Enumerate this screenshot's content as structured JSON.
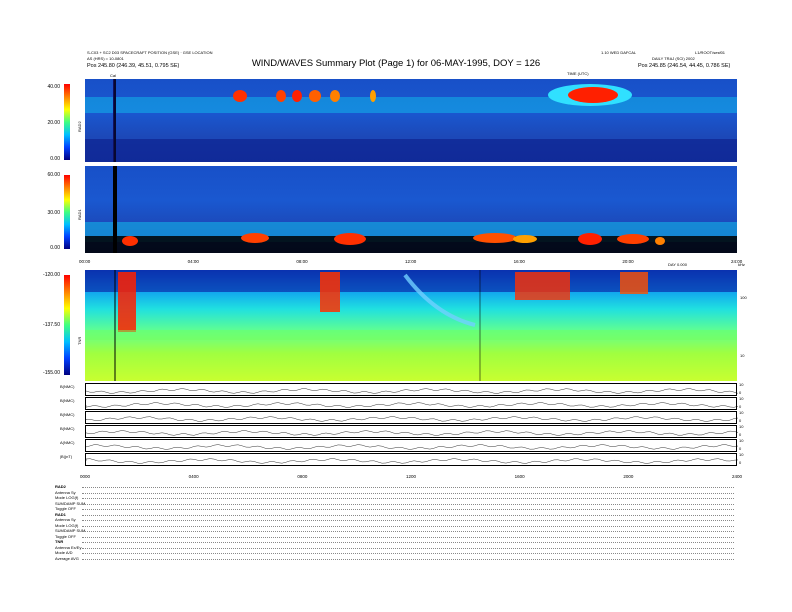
{
  "header": {
    "title": "WIND/WAVES Summary Plot (Page 1) for 06-MAY-1995, DOY = 126",
    "left_line1": "S-C03 + SC2 D03 SPACECRAFT POSITION (GSE) · GSE LOCATION",
    "left_line2": "AS (HRS) = 10-0801",
    "left_pos": "Pos  245.80 (246.39, 45.51, 0.795 SE)",
    "right_top_center": "1.10 WED DAFCAL",
    "right_top_right": "L1/ROOT/sesf01",
    "right_line2": "DAILY TRAJ (SCI) 2002",
    "right_pos": "Pos  245.85 (246.54, 44.45, 0.786 SE)",
    "time_label": "TIME (UTC)",
    "cal_label": "Cal"
  },
  "chart_data": [
    {
      "type": "heatmap",
      "name": "RAD2",
      "yticks": [
        "40.00",
        "20.00",
        "0.00"
      ],
      "ylim": [
        0,
        40
      ]
    },
    {
      "type": "heatmap",
      "name": "RAD1",
      "yticks": [
        "60.00",
        "30.00",
        "0.00"
      ],
      "ylim": [
        0,
        60
      ]
    },
    {
      "type": "heatmap",
      "name": "TNR",
      "yticks": [
        "-120.00",
        "-137.50",
        "-155.00"
      ],
      "right_ticks": [
        "100",
        "10"
      ],
      "right_unit": "kHz",
      "ylim": [
        -155,
        -120
      ]
    }
  ],
  "xaxis": {
    "ticks_top": [
      "00:00",
      "04:00",
      "08:00",
      "12:00",
      "16:00",
      "20:00",
      "24:00"
    ],
    "ticks_bottom": [
      "0000",
      "0400",
      "0800",
      "1200",
      "1600",
      "2000",
      "2400"
    ],
    "label": "DAY 0.000"
  },
  "strips": [
    {
      "label": "B(NMC)",
      "r1": "10",
      "r2": "0"
    },
    {
      "label": "B(NMC)",
      "r1": "10",
      "r2": "0"
    },
    {
      "label": "B(NMC)",
      "r1": "10",
      "r2": "0"
    },
    {
      "label": "B(NMC)",
      "r1": "10",
      "r2": "0"
    },
    {
      "label": "A(NMC)",
      "r1": "10",
      "r2": "0"
    },
    {
      "label": "|B|(nT)",
      "r1": "10",
      "r2": "0"
    }
  ],
  "receiver_groups": [
    {
      "name": "RAD2",
      "rows": [
        "Antenna  Sy",
        "Mode   LOG(f)",
        "SUMDAMP SUM",
        "Toggle   OFF"
      ]
    },
    {
      "name": "RAD1",
      "rows": [
        "Antenna  Sy",
        "Mode   LOG(f)",
        "SUMDAMP SUM",
        "Toggle   OFF"
      ]
    },
    {
      "name": "TNR",
      "rows": [
        "Antenna  Ex/Ey",
        "Mode   A/D",
        "Average  AVG"
      ]
    }
  ]
}
